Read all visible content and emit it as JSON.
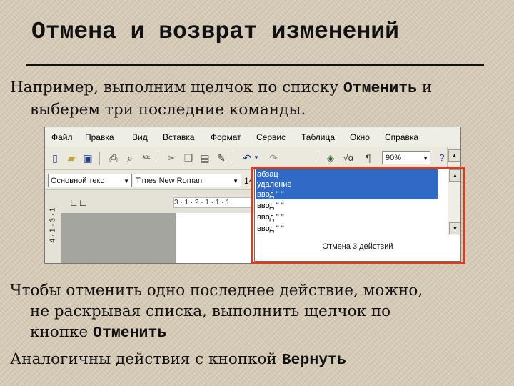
{
  "slide": {
    "title": "Отмена и возврат изменений",
    "p1_before": "Например, выполним щелчок по списку ",
    "p1_kw": "Отменить",
    "p1_after": " и",
    "p1_line2": "выберем три последние команды.",
    "p2_line1": "Чтобы отменить одно последнее действие, можно,",
    "p2_line2": "не раскрывая списка, выполнить щелчок по",
    "p2_line3_before": "кнопке ",
    "p2_kw": "Отменить",
    "p3_before": "Аналогичны действия с кнопкой ",
    "p3_kw": "Вернуть"
  },
  "word": {
    "menu": [
      "Файл",
      "Правка",
      "Вид",
      "Вставка",
      "Формат",
      "Сервис",
      "Таблица",
      "Окно",
      "Справка"
    ],
    "zoom": "90%",
    "style": "Основной текст",
    "font": "Times New Roman",
    "font_size": "14",
    "ruler_marks": "3 · 1 · 2 · 1 · 1 · 1",
    "vruler_marks": "4 · 1 · 3 · 1",
    "undo_items": [
      "абзац",
      "удаление",
      "ввод \" \"",
      "ввод \" \"",
      "ввод \" \"",
      "ввод \" \""
    ],
    "undo_footer": "Отмена 3 действий"
  },
  "colors": {
    "background": "#d9cdb9",
    "selection": "#3169c6",
    "highlight_frame": "#e03b1f"
  },
  "icons": [
    "new-document-icon",
    "open-folder-icon",
    "save-icon",
    "print-icon",
    "print-preview-icon",
    "spelling-icon",
    "cut-icon",
    "copy-icon",
    "paste-icon",
    "format-painter-icon",
    "undo-icon",
    "redo-icon",
    "insert-hyperlink-icon",
    "equation-icon",
    "pilcrow-icon",
    "help-icon"
  ]
}
